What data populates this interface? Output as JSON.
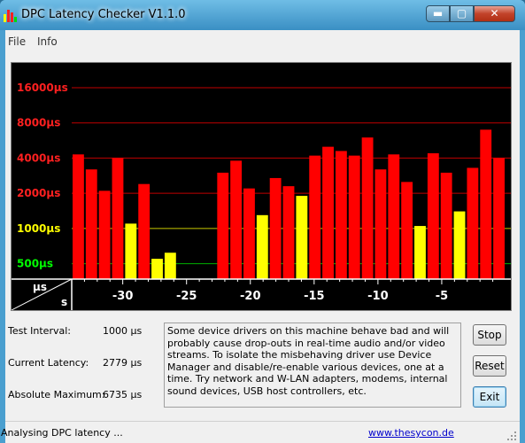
{
  "window": {
    "title": "DPC Latency Checker V1.1.0",
    "controls": {
      "minimize": "▬",
      "maximize": "▢",
      "close": "✕"
    },
    "colors": {
      "titlebar": "#4a9fcf",
      "close": "#c2432a"
    }
  },
  "menu": {
    "items": [
      "File",
      "Info"
    ]
  },
  "chart_data": {
    "type": "bar",
    "y_tick_labels": [
      "16000µs",
      "8000µs",
      "4000µs",
      "2000µs",
      "1000µs",
      "500µs"
    ],
    "y_tick_colors": [
      "#ff2020",
      "#ff2020",
      "#ff2020",
      "#ff2020",
      "#ffff00",
      "#00ff00"
    ],
    "y_ticks": [
      16000,
      8000,
      4000,
      2000,
      1000,
      500
    ],
    "gridline_colors": [
      "#c00000",
      "#c00000",
      "#c00000",
      "#c00000",
      "#c8c800",
      "#00b000"
    ],
    "scale": "log",
    "xlabel": "s",
    "ylabel": "µs",
    "x_tick_labels": [
      "-30",
      "-25",
      "-20",
      "-15",
      "-10",
      "-5"
    ],
    "x_ticks": [
      -30,
      -25,
      -20,
      -15,
      -10,
      -5
    ],
    "x_range": [
      -34,
      0
    ],
    "thresholds": {
      "green_below": 500,
      "yellow_below": 2000
    },
    "bar_colors": {
      "red": "#ff0000",
      "yellow": "#ffff00",
      "green": "#00dd00"
    },
    "values": [
      4300,
      3200,
      2100,
      4000,
      1100,
      2400,
      550,
      620,
      330,
      330,
      330,
      3000,
      3800,
      2200,
      1300,
      2700,
      2300,
      1900,
      4200,
      5000,
      4600,
      4200,
      6000,
      3200,
      4300,
      2500,
      1050,
      4400,
      3000,
      1400,
      3300,
      7000,
      4000
    ]
  },
  "stats": {
    "test_interval": {
      "label": "Test Interval:",
      "value": "1000 µs"
    },
    "current_latency": {
      "label": "Current Latency:",
      "value": "2779 µs"
    },
    "absolute_maximum": {
      "label": "Absolute Maximum:",
      "value": "6735 µs"
    }
  },
  "info_text": "Some device drivers on this machine behave bad and will probably cause drop-outs in real-time audio and/or video streams. To isolate the misbehaving driver use Device Manager and disable/re-enable various devices, one at a time. Try network and W-LAN adapters, modems, internal sound devices, USB host controllers, etc.",
  "buttons": {
    "stop": "Stop",
    "reset": "Reset",
    "exit": "Exit"
  },
  "status": {
    "text": "Analysing DPC latency ...",
    "link": "www.thesycon.de"
  }
}
